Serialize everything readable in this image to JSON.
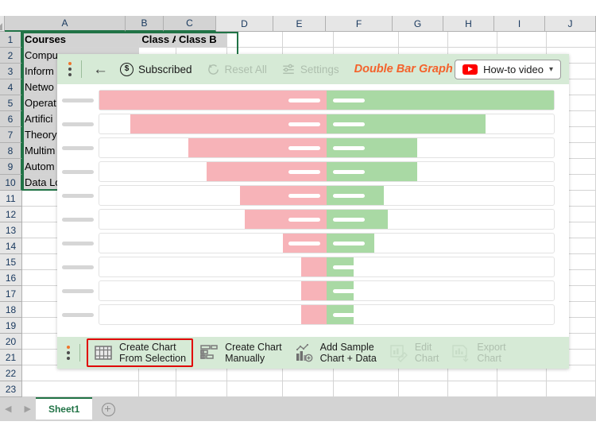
{
  "spreadsheet": {
    "column_headers": [
      "A",
      "B",
      "C",
      "D",
      "E",
      "F",
      "G",
      "H",
      "I",
      "J"
    ],
    "selected_columns": [
      "A",
      "B",
      "C"
    ],
    "row_headers": [
      "1",
      "2",
      "3",
      "4",
      "5",
      "6",
      "7",
      "8",
      "9",
      "10",
      "11",
      "12",
      "13",
      "14",
      "15",
      "16",
      "17",
      "18",
      "19",
      "20",
      "21",
      "22",
      "23"
    ],
    "selected_rows": [
      "1",
      "2",
      "3",
      "4",
      "5",
      "6",
      "7",
      "8",
      "9",
      "10"
    ],
    "cells": {
      "A1": "Courses",
      "B1": "Class A",
      "C1": "Class B",
      "A2": "Compu",
      "A3": "Inform",
      "A4": "Netwo",
      "A5": "Operat",
      "A6": "Artifici",
      "A7": "Theory",
      "A8": "Multim",
      "A9": "Autom",
      "A10": "Data Lo"
    },
    "sheet_tab": "Sheet1",
    "add_sheet_icon": "plus-circle-icon",
    "nav_prev_icon": "triangle-left-icon",
    "nav_next_icon": "triangle-right-icon"
  },
  "panel": {
    "title": "Double Bar Graph",
    "drag_handle_icon": "drag-dots-icon",
    "back_icon": "arrow-left-icon",
    "toolbar": [
      {
        "label": "Subscribed",
        "icon": "dollar-coin-icon",
        "disabled": false
      },
      {
        "label": "Reset All",
        "icon": "reset-arrow-icon",
        "disabled": true
      },
      {
        "label": "Settings",
        "icon": "sliders-icon",
        "disabled": true
      }
    ],
    "video_button": {
      "label": "How-to video",
      "icon": "youtube-icon",
      "chevron": "chevron-down-icon"
    },
    "actions": [
      {
        "label_line1": "Create Chart",
        "label_line2": "From Selection",
        "icon": "table-grid-icon",
        "disabled": false,
        "selected": true
      },
      {
        "label_line1": "Create Chart",
        "label_line2": "Manually",
        "icon": "form-layout-icon",
        "disabled": false,
        "selected": false
      },
      {
        "label_line1": "Add Sample",
        "label_line2": "Chart + Data",
        "icon": "chart-plus-icon",
        "disabled": false,
        "selected": false
      },
      {
        "label_line1": "Edit",
        "label_line2": "Chart",
        "icon": "edit-chart-icon",
        "disabled": true,
        "selected": false
      },
      {
        "label_line1": "Export",
        "label_line2": "Chart",
        "icon": "export-chart-icon",
        "disabled": true,
        "selected": false
      }
    ],
    "colors": {
      "toolbar_bg": "#d6ead6",
      "title": "#f4622b",
      "left_series": "#f7b3b8",
      "right_series": "#a9d9a4",
      "selection_outline": "#e00000",
      "excel_green": "#217346"
    }
  },
  "chart_data": {
    "type": "bar",
    "title": "Double Bar Graph",
    "orientation": "horizontal-diverging",
    "placeholder": true,
    "categories": [
      "",
      "",
      "",
      "",
      "",
      "",
      "",
      "",
      "",
      ""
    ],
    "xlabel": "",
    "ylabel": "",
    "grid": false,
    "legend": "none",
    "axis_center_pct": 50,
    "series": [
      {
        "name": "left",
        "color": "#f7b3b8",
        "values": [
          89,
          77,
          54,
          47,
          34,
          32,
          17,
          10,
          10,
          10
        ]
      },
      {
        "name": "right",
        "color": "#a9d9a4",
        "values": [
          100,
          70,
          40,
          40,
          25,
          27,
          21,
          12,
          12,
          12
        ]
      }
    ]
  }
}
